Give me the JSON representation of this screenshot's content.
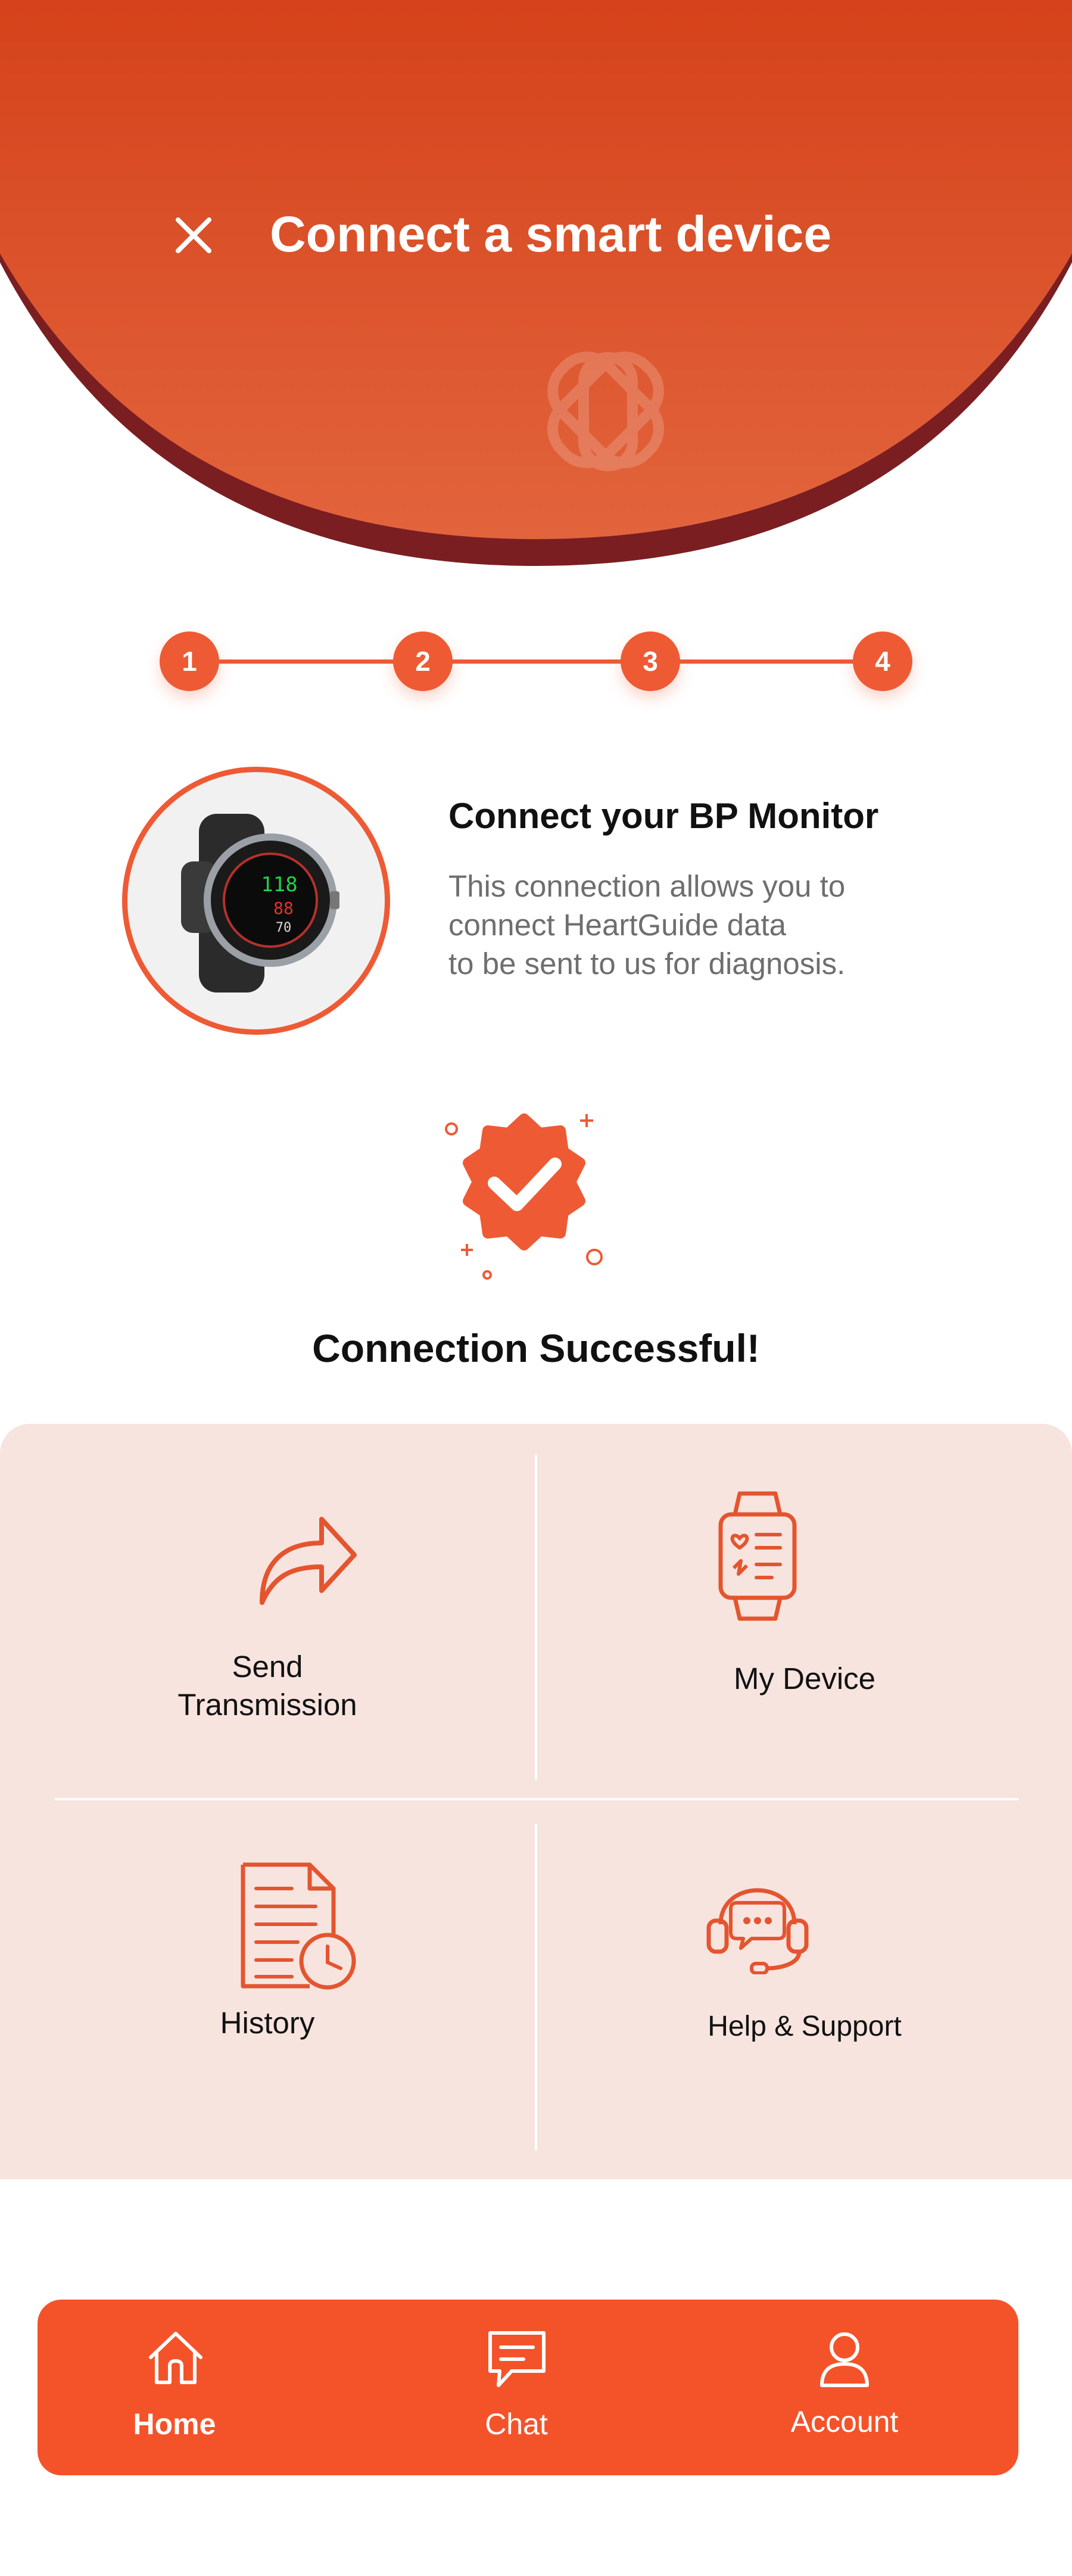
{
  "header": {
    "title": "Connect a smart device",
    "close_icon": "close-icon",
    "logo_icon": "interlocked-cross-logo",
    "colors": {
      "gradient_top": "#d5421b",
      "gradient_bottom": "#e2643c",
      "rim": "#7a1e22"
    }
  },
  "stepper": {
    "steps": [
      "1",
      "2",
      "3",
      "4"
    ],
    "color": "#ee5a34"
  },
  "device": {
    "title": "Connect your BP Monitor",
    "description_lines": [
      "This connection allows you to",
      "connect HeartGuide data",
      "to be sent to us for diagnosis."
    ],
    "image_icon": "smartwatch-image",
    "watch_readings": [
      "118",
      "88",
      "70"
    ]
  },
  "status": {
    "icon": "check-badge-icon",
    "text": "Connection Successful!"
  },
  "actions": [
    {
      "label_lines": [
        "Send",
        "Transmission"
      ],
      "icon": "share-arrow-icon"
    },
    {
      "label_lines": [
        "My Device"
      ],
      "icon": "smartwatch-icon"
    },
    {
      "label_lines": [
        "History"
      ],
      "icon": "document-clock-icon"
    },
    {
      "label_lines": [
        "Help & Support"
      ],
      "icon": "headset-chat-icon"
    }
  ],
  "nav": {
    "items": [
      {
        "label": "Home",
        "icon": "home-icon",
        "active": true
      },
      {
        "label": "Chat",
        "icon": "chat-icon",
        "active": false
      },
      {
        "label": "Account",
        "icon": "user-icon",
        "active": false
      }
    ],
    "color": "#f4532a"
  }
}
